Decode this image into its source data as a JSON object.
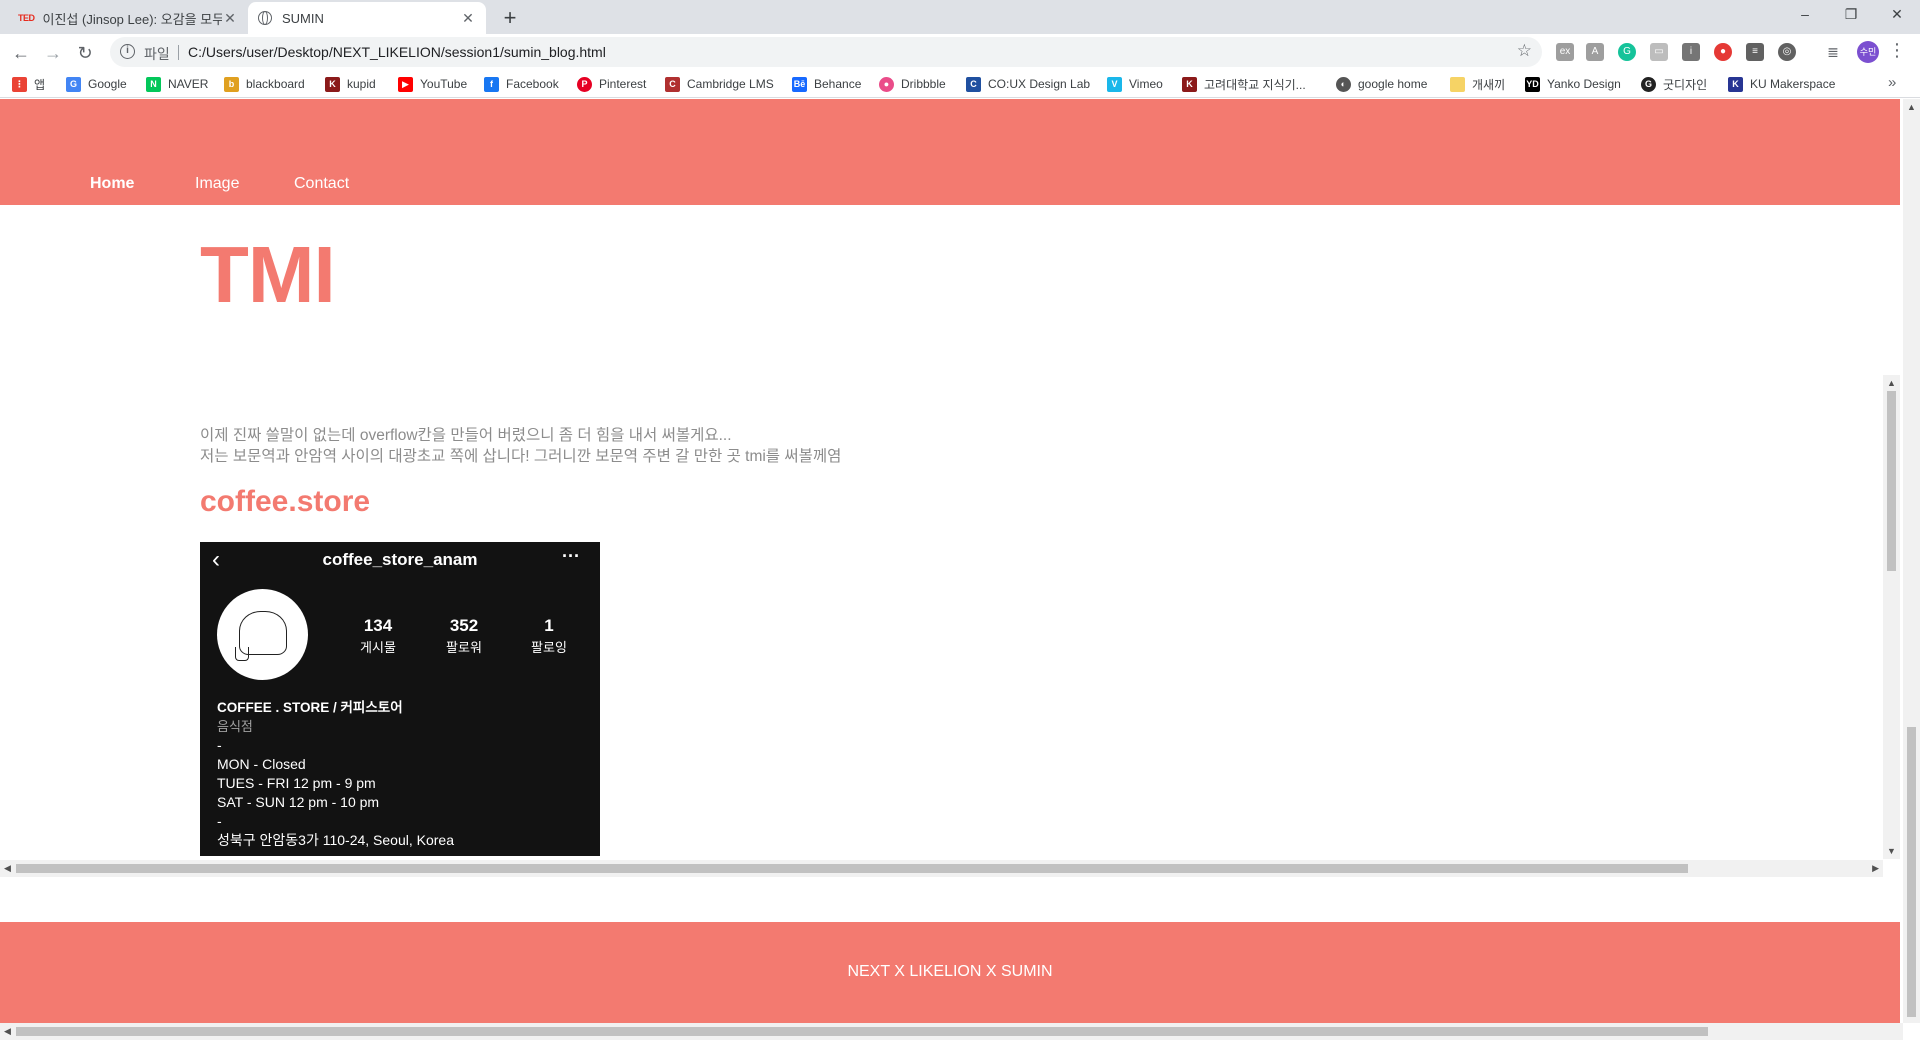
{
  "browser": {
    "tabs": [
      {
        "favicon": "TED",
        "title": "이진섭 (Jinsop Lee): 오감을 모두",
        "active": false
      },
      {
        "favicon": "globe-icon",
        "title": "SUMIN",
        "active": true
      }
    ],
    "new_tab": "+",
    "window_controls": {
      "minimize": "–",
      "restore": "❐",
      "close": "✕"
    },
    "nav": {
      "back": "←",
      "forward": "→",
      "reload": "↻"
    },
    "address": {
      "scheme_label": "파일",
      "url": "C:/Users/user/Desktop/NEXT_LIKELION/session1/sumin_blog.html"
    },
    "profile_initials": "수민",
    "bookmarks": [
      {
        "label": "앱",
        "icon": "apps-grid-icon",
        "color": "#ea4335"
      },
      {
        "label": "Google",
        "icon": "google-icon",
        "color": "#4285f4"
      },
      {
        "label": "NAVER",
        "icon": "naver-icon",
        "color": "#03c75a"
      },
      {
        "label": "blackboard",
        "icon": "blackboard-icon",
        "color": "#e0a020"
      },
      {
        "label": "kupid",
        "icon": "kupid-icon",
        "color": "#8b1a1a"
      },
      {
        "label": "YouTube",
        "icon": "youtube-icon",
        "color": "#ff0000"
      },
      {
        "label": "Facebook",
        "icon": "facebook-icon",
        "color": "#1877f2"
      },
      {
        "label": "Pinterest",
        "icon": "pinterest-icon",
        "color": "#e60023"
      },
      {
        "label": "Cambridge LMS",
        "icon": "cambridge-icon",
        "color": "#b03030"
      },
      {
        "label": "Behance",
        "icon": "behance-icon",
        "color": "#1769ff"
      },
      {
        "label": "Dribbble",
        "icon": "dribbble-icon",
        "color": "#ea4c89"
      },
      {
        "label": "CO:UX Design Lab",
        "icon": "coux-icon",
        "color": "#2050a0"
      },
      {
        "label": "Vimeo",
        "icon": "vimeo-icon",
        "color": "#1ab7ea"
      },
      {
        "label": "고려대학교 지식기...",
        "icon": "korea-univ-icon",
        "color": "#8b1a1a"
      },
      {
        "label": "google home",
        "icon": "google-home-icon",
        "color": "#555555"
      },
      {
        "label": "개새끼",
        "icon": "folder-icon",
        "color": "#f6d365"
      },
      {
        "label": "Yanko Design",
        "icon": "yanko-icon",
        "color": "#000000"
      },
      {
        "label": "굿디자인",
        "icon": "good-design-icon",
        "color": "#222222"
      },
      {
        "label": "KU Makerspace",
        "icon": "makerspace-icon",
        "color": "#283593"
      }
    ],
    "bookmarks_overflow": "»"
  },
  "site": {
    "nav": [
      "Home",
      "Image",
      "Contact"
    ],
    "title": "TMI",
    "intro": [
      "이제 진짜 쓸말이 없는데 overflow칸을 만들어 버렸으니 좀 더 힘을 내서 써볼게요...",
      "저는 보문역과 안암역 사이의 대광초교 쪽에 삽니다! 그러니깐 보문역 주변 갈 만한 곳 tmi를 써볼께염"
    ],
    "section_heading": "coffee.store",
    "instagram": {
      "back": "‹",
      "handle": "coffee_store_anam",
      "more": "···",
      "stats": [
        {
          "count": "134",
          "label": "게시물"
        },
        {
          "count": "352",
          "label": "팔로워"
        },
        {
          "count": "1",
          "label": "팔로잉"
        }
      ],
      "name": "COFFEE . STORE / 커피스토어",
      "category": "음식점",
      "bio_lines": [
        "-",
        "MON - Closed",
        "TUES - FRI 12 pm - 9 pm",
        "SAT - SUN 12 pm - 10 pm",
        "-",
        "성북구 안암동3가 110-24, Seoul, Korea"
      ]
    },
    "footer": "NEXT X LIKELION X SUMIN"
  },
  "colors": {
    "brand": "#f37a70",
    "chrome_bg": "#dee1e6",
    "insta_bg": "#121212"
  }
}
